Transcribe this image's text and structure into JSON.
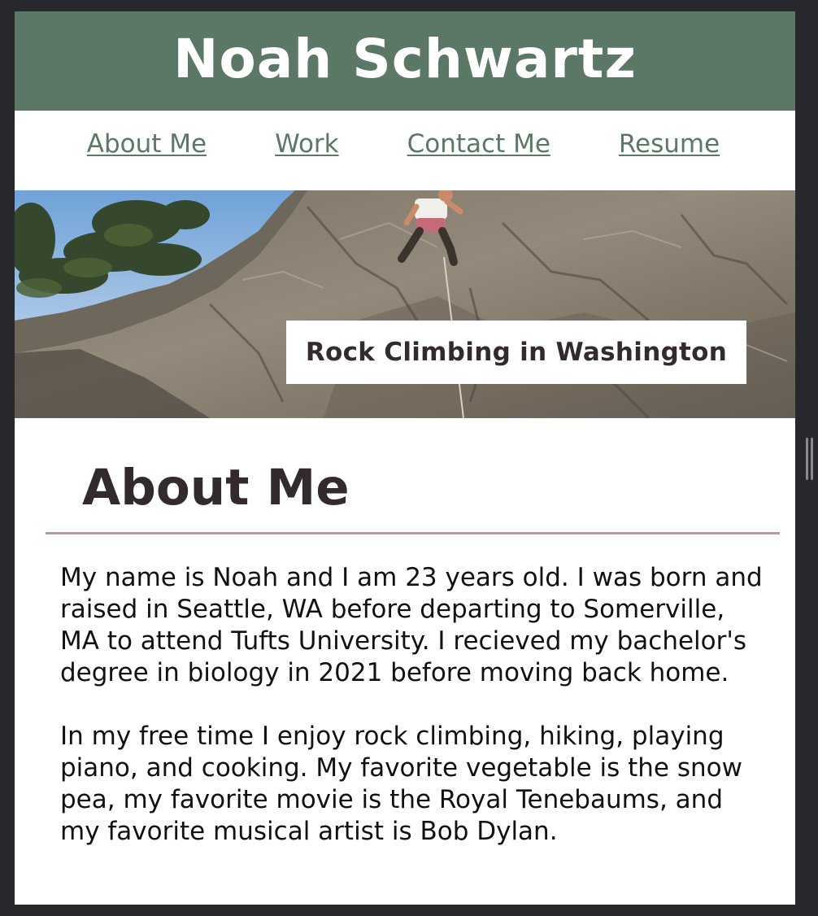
{
  "header": {
    "title": "Noah Schwartz"
  },
  "nav": {
    "items": [
      {
        "label": "About Me"
      },
      {
        "label": "Work"
      },
      {
        "label": "Contact Me"
      },
      {
        "label": "Resume"
      }
    ]
  },
  "hero": {
    "caption": "Rock Climbing in Washington"
  },
  "about": {
    "heading": "About Me",
    "paragraphs": [
      "My name is Noah and I am 23 years old. I was born and raised in Seattle, WA before departing to Somerville, MA to attend Tufts University. I recieved my bachelor's degree in biology in 2021 before moving back home.",
      "In my free time I enjoy rock climbing, hiking, playing piano, and cooking. My favorite vegetable is the snow pea, my favorite movie is the Royal Tenebaums, and my favorite musical artist is Bob Dylan."
    ]
  },
  "colors": {
    "header_bg": "#5b7766",
    "link": "#5b7766",
    "heading_text": "#322a2f",
    "divider": "#b59c9c",
    "window_bg": "#28272b"
  }
}
